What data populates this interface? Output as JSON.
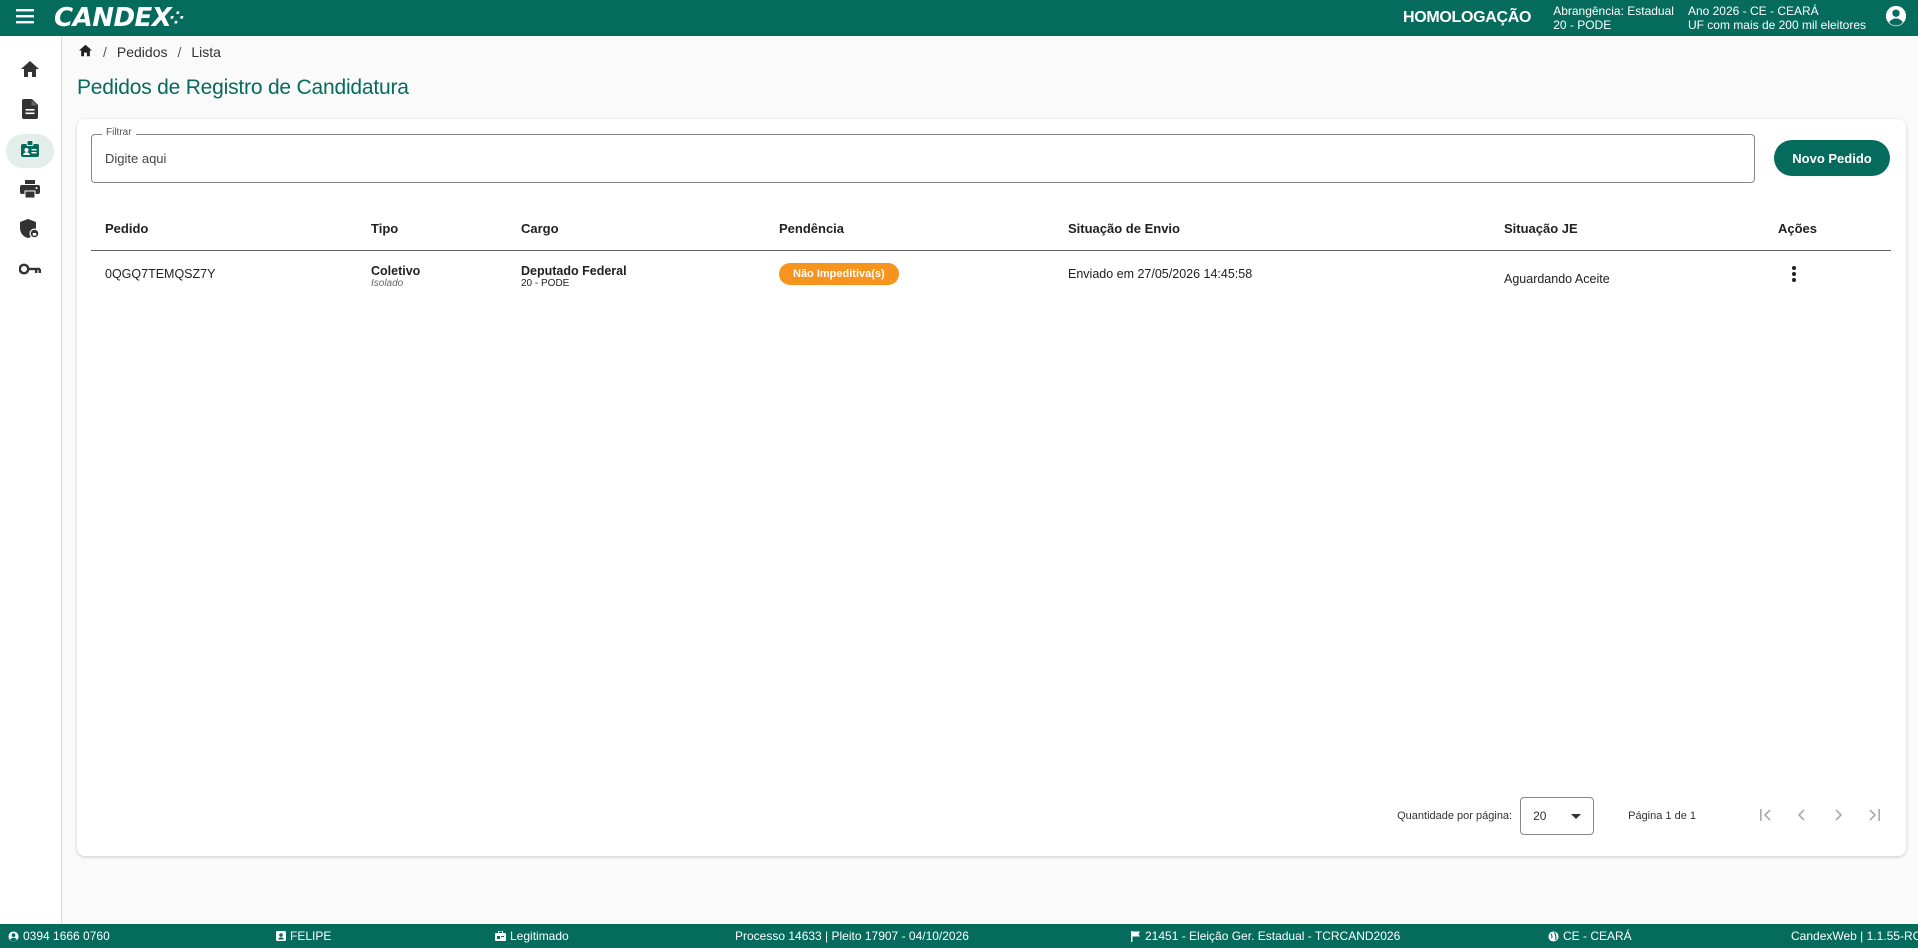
{
  "topbar": {
    "logo": "CANDEX",
    "environment": "HOMOLOGAÇÃO",
    "scope_line1": "Abrangência: Estadual",
    "scope_line2": "20 - PODE",
    "year_line1": "Ano 2026 - CE - CEARÁ",
    "year_line2": "UF com mais de 200 mil eleitores"
  },
  "sidenav": {
    "items": [
      {
        "icon": "home-icon"
      },
      {
        "icon": "document-icon"
      },
      {
        "icon": "candidate-badge-icon"
      },
      {
        "icon": "printer-icon"
      },
      {
        "icon": "shield-lock-icon"
      },
      {
        "icon": "key-icon"
      }
    ]
  },
  "breadcrumb": {
    "level1": "Pedidos",
    "level2": "Lista"
  },
  "page_title": "Pedidos de Registro de Candidatura",
  "filter": {
    "label": "Filtrar",
    "placeholder": "Digite aqui",
    "value": ""
  },
  "new_button": "Novo Pedido",
  "table": {
    "headers": [
      "Pedido",
      "Tipo",
      "Cargo",
      "Pendência",
      "Situação de Envio",
      "Situação JE",
      "Ações"
    ],
    "rows": [
      {
        "pedido": "0QGQ7TEMQSZ7Y",
        "tipo": "Coletivo",
        "tipo_sub": "Isolado",
        "cargo": "Deputado Federal",
        "cargo_sub": "20 - PODE",
        "pendencia": "Não Impeditiva(s)",
        "situacao_envio": "Enviado em 27/05/2026 14:45:58",
        "situacao_je": "Aguardando Aceite"
      }
    ]
  },
  "pager": {
    "per_page_label": "Quantidade por página:",
    "per_page_value": "20",
    "page_info": "Página 1 de 1"
  },
  "footer": {
    "phone": "0394 1666 0760",
    "user": "FELIPE",
    "status": "Legitimado",
    "process": "Processo 14633 | Pleito 17907 - 04/10/2026",
    "election": "21451 - Eleição Ger. Estadual - TCRCAND2026",
    "region": "CE - CEARÁ",
    "version": "CandexWeb | 1.1.55-RC"
  },
  "colors": {
    "primary": "#056b5c",
    "badge_warning": "#f7941d"
  }
}
